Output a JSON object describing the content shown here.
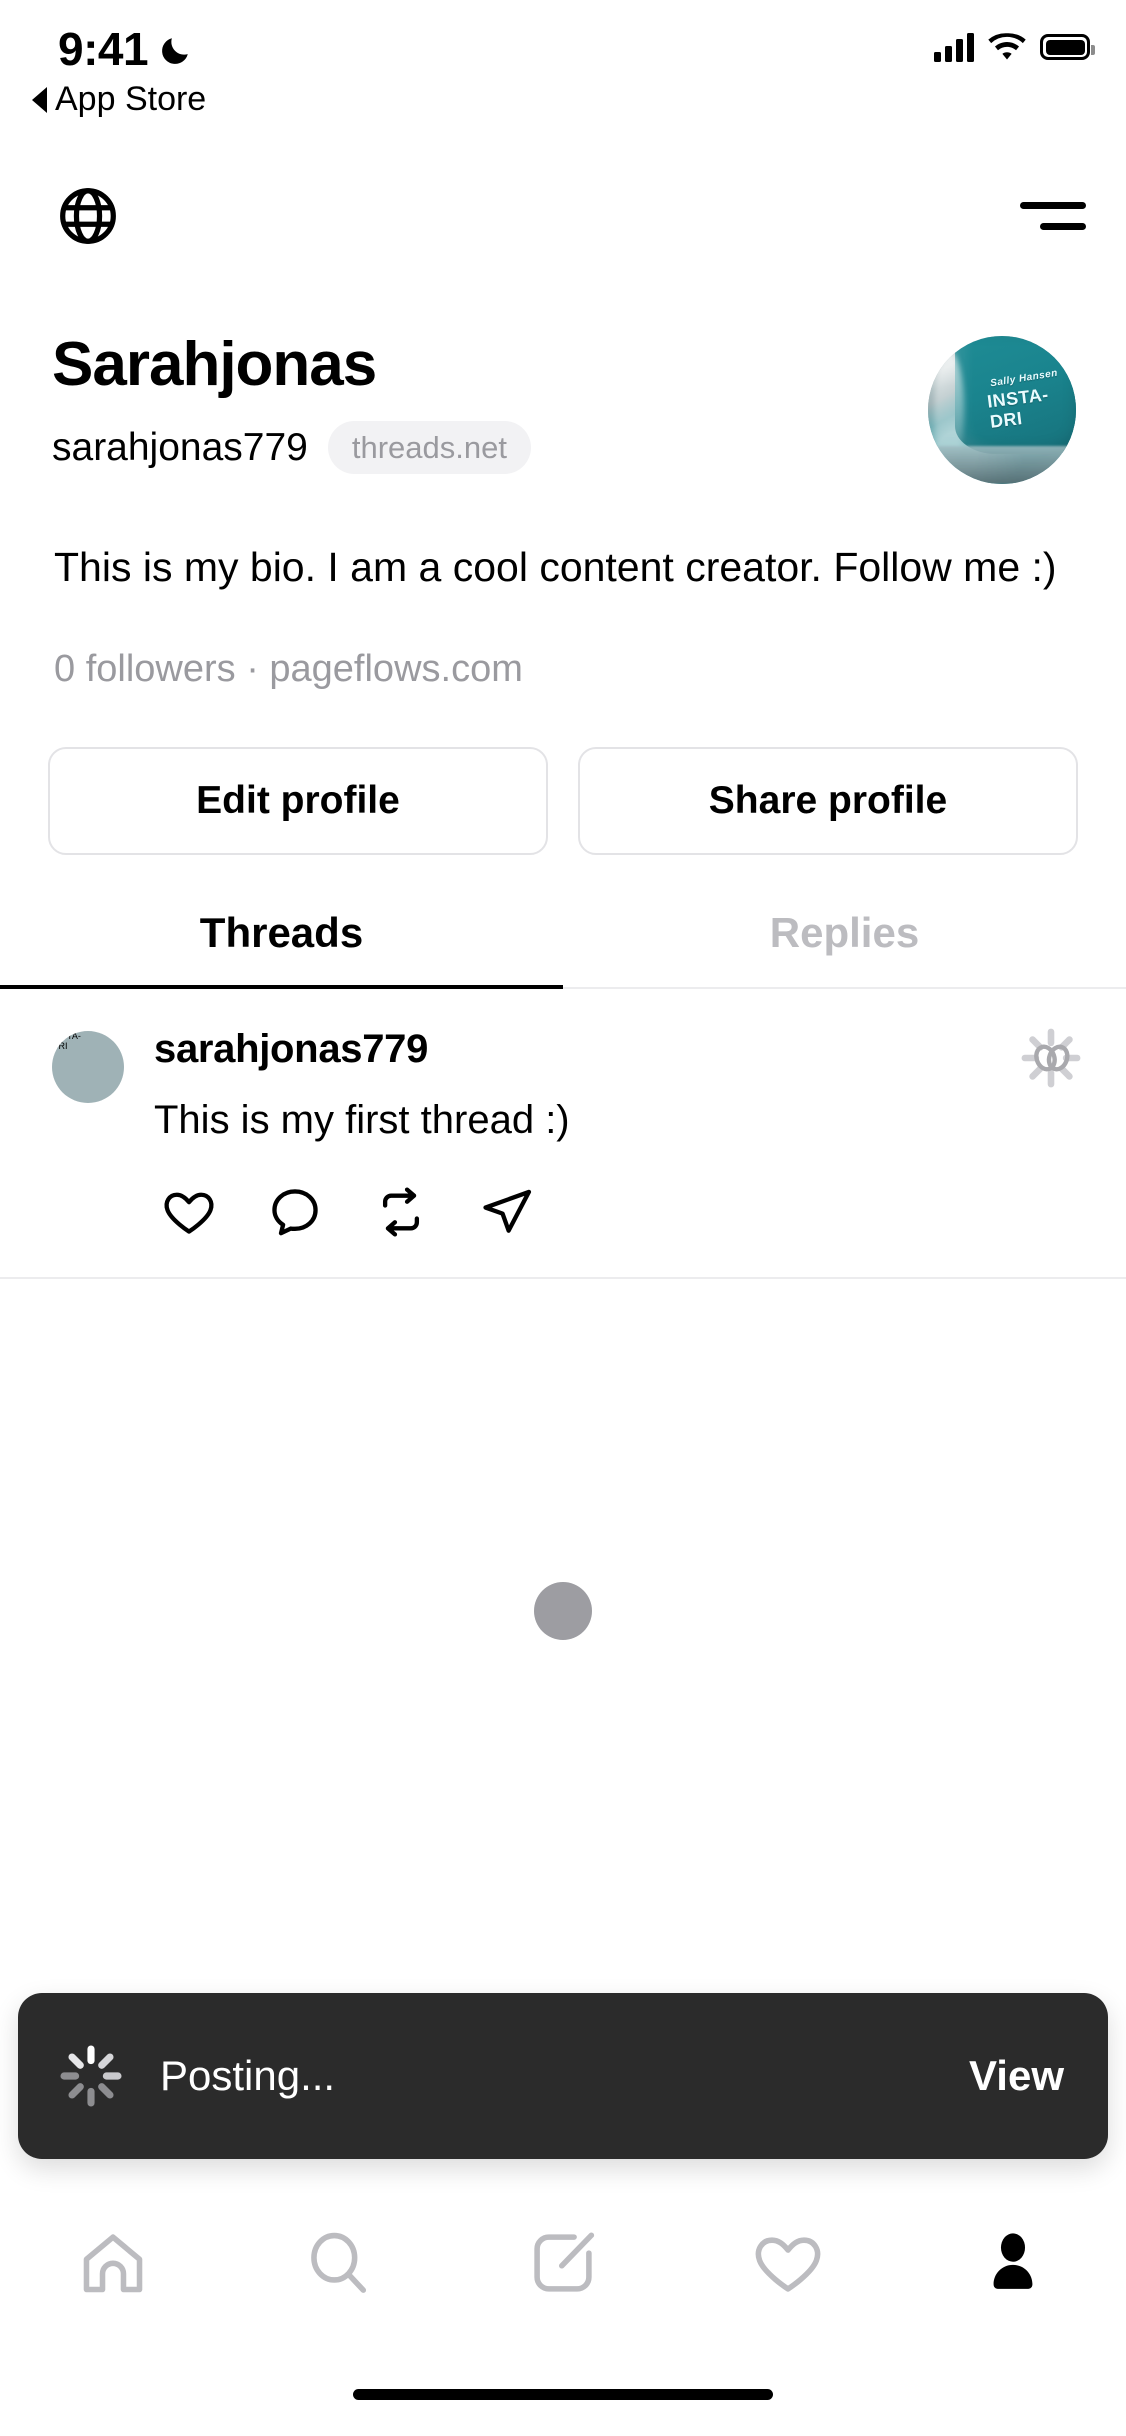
{
  "status_bar": {
    "time": "9:41",
    "dnd_icon": "crescent-moon-icon",
    "back_label": "App Store",
    "cellular_icon": "signal-bars-icon",
    "wifi_icon": "wifi-icon",
    "battery_icon": "battery-full-icon"
  },
  "top_nav": {
    "globe_icon": "globe-icon",
    "menu_icon": "hamburger-menu-icon"
  },
  "profile": {
    "display_name": "Sarahjonas",
    "username": "sarahjonas779",
    "domain_badge": "threads.net",
    "bio": "This is my bio. I am a cool content creator. Follow me :)",
    "meta": "0 followers · pageflows.com",
    "avatar_alt": "nail-polish-bottle-avatar",
    "edit_button": "Edit profile",
    "share_button": "Share profile"
  },
  "tabs": [
    {
      "label": "Threads",
      "active": true
    },
    {
      "label": "Replies",
      "active": false
    }
  ],
  "thread": {
    "username": "sarahjonas779",
    "text": "This is my first thread :)",
    "pending_icon": "loading-spinner-icon",
    "actions": [
      {
        "name": "like-icon",
        "label": "Like"
      },
      {
        "name": "reply-icon",
        "label": "Reply"
      },
      {
        "name": "repost-icon",
        "label": "Repost"
      },
      {
        "name": "share-icon",
        "label": "Share"
      }
    ]
  },
  "loading_placeholder": {
    "icon": "loading-dot-icon"
  },
  "toast": {
    "spinner_icon": "loading-spinner-icon",
    "message": "Posting...",
    "action_label": "View",
    "background": "#2b2b2b"
  },
  "tabbar": [
    {
      "name": "tab-home",
      "icon": "home-icon",
      "active": false
    },
    {
      "name": "tab-search",
      "icon": "search-icon",
      "active": false
    },
    {
      "name": "tab-compose",
      "icon": "compose-icon",
      "active": false
    },
    {
      "name": "tab-activity",
      "icon": "heart-icon",
      "active": false
    },
    {
      "name": "tab-profile",
      "icon": "person-icon",
      "active": true
    }
  ],
  "colors": {
    "text_primary": "#000000",
    "text_secondary": "#9a9a9f",
    "border": "#ececee",
    "inactive_icon": "#bcbcc0",
    "toast_bg": "#2b2b2b"
  }
}
